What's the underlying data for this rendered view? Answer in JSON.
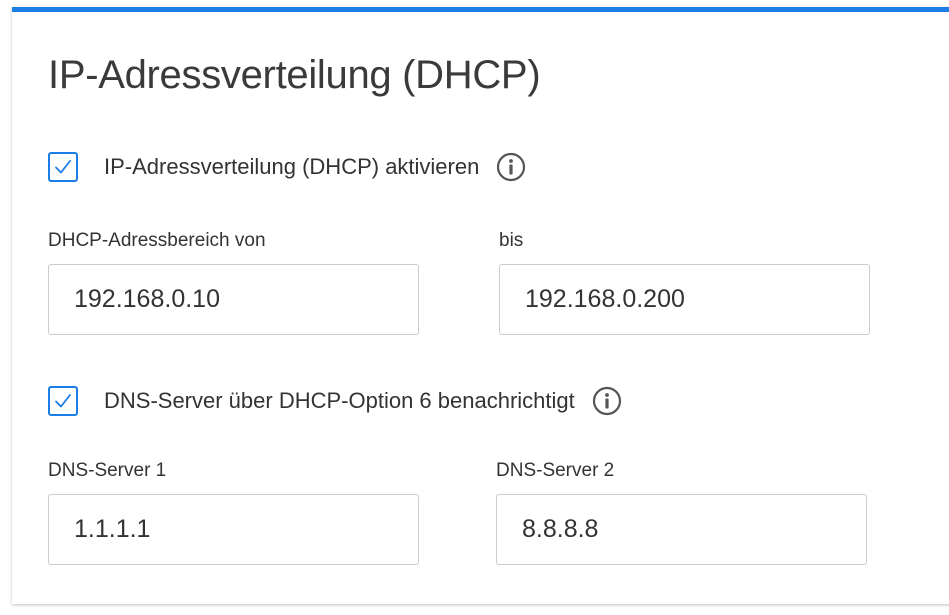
{
  "section": {
    "title": "IP-Adressverteilung (DHCP)"
  },
  "dhcp": {
    "enable_label": "IP-Adressverteilung (DHCP) aktivieren",
    "enabled": true,
    "range_from_label": "DHCP-Adressbereich von",
    "range_from_value": "192.168.0.10",
    "range_to_label": "bis",
    "range_to_value": "192.168.0.200"
  },
  "dns": {
    "option6_label": "DNS-Server über DHCP-Option 6 benachrichtigt",
    "option6_enabled": true,
    "server1_label": "DNS-Server 1",
    "server1_value": "1.1.1.1",
    "server2_label": "DNS-Server 2",
    "server2_value": "8.8.8.8"
  },
  "colors": {
    "accent": "#1a7ee6",
    "text": "#333333",
    "border": "#cccccc",
    "icon": "#555555"
  },
  "icons": {
    "checkbox_check": "check-icon",
    "info": "info-icon"
  }
}
